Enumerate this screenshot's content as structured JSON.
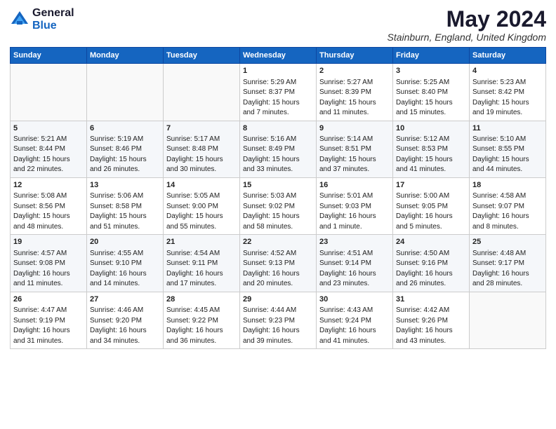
{
  "header": {
    "logo_general": "General",
    "logo_blue": "Blue",
    "month_title": "May 2024",
    "location": "Stainburn, England, United Kingdom"
  },
  "weekdays": [
    "Sunday",
    "Monday",
    "Tuesday",
    "Wednesday",
    "Thursday",
    "Friday",
    "Saturday"
  ],
  "weeks": [
    [
      {
        "day": "",
        "info": ""
      },
      {
        "day": "",
        "info": ""
      },
      {
        "day": "",
        "info": ""
      },
      {
        "day": "1",
        "info": "Sunrise: 5:29 AM\nSunset: 8:37 PM\nDaylight: 15 hours\nand 7 minutes."
      },
      {
        "day": "2",
        "info": "Sunrise: 5:27 AM\nSunset: 8:39 PM\nDaylight: 15 hours\nand 11 minutes."
      },
      {
        "day": "3",
        "info": "Sunrise: 5:25 AM\nSunset: 8:40 PM\nDaylight: 15 hours\nand 15 minutes."
      },
      {
        "day": "4",
        "info": "Sunrise: 5:23 AM\nSunset: 8:42 PM\nDaylight: 15 hours\nand 19 minutes."
      }
    ],
    [
      {
        "day": "5",
        "info": "Sunrise: 5:21 AM\nSunset: 8:44 PM\nDaylight: 15 hours\nand 22 minutes."
      },
      {
        "day": "6",
        "info": "Sunrise: 5:19 AM\nSunset: 8:46 PM\nDaylight: 15 hours\nand 26 minutes."
      },
      {
        "day": "7",
        "info": "Sunrise: 5:17 AM\nSunset: 8:48 PM\nDaylight: 15 hours\nand 30 minutes."
      },
      {
        "day": "8",
        "info": "Sunrise: 5:16 AM\nSunset: 8:49 PM\nDaylight: 15 hours\nand 33 minutes."
      },
      {
        "day": "9",
        "info": "Sunrise: 5:14 AM\nSunset: 8:51 PM\nDaylight: 15 hours\nand 37 minutes."
      },
      {
        "day": "10",
        "info": "Sunrise: 5:12 AM\nSunset: 8:53 PM\nDaylight: 15 hours\nand 41 minutes."
      },
      {
        "day": "11",
        "info": "Sunrise: 5:10 AM\nSunset: 8:55 PM\nDaylight: 15 hours\nand 44 minutes."
      }
    ],
    [
      {
        "day": "12",
        "info": "Sunrise: 5:08 AM\nSunset: 8:56 PM\nDaylight: 15 hours\nand 48 minutes."
      },
      {
        "day": "13",
        "info": "Sunrise: 5:06 AM\nSunset: 8:58 PM\nDaylight: 15 hours\nand 51 minutes."
      },
      {
        "day": "14",
        "info": "Sunrise: 5:05 AM\nSunset: 9:00 PM\nDaylight: 15 hours\nand 55 minutes."
      },
      {
        "day": "15",
        "info": "Sunrise: 5:03 AM\nSunset: 9:02 PM\nDaylight: 15 hours\nand 58 minutes."
      },
      {
        "day": "16",
        "info": "Sunrise: 5:01 AM\nSunset: 9:03 PM\nDaylight: 16 hours\nand 1 minute."
      },
      {
        "day": "17",
        "info": "Sunrise: 5:00 AM\nSunset: 9:05 PM\nDaylight: 16 hours\nand 5 minutes."
      },
      {
        "day": "18",
        "info": "Sunrise: 4:58 AM\nSunset: 9:07 PM\nDaylight: 16 hours\nand 8 minutes."
      }
    ],
    [
      {
        "day": "19",
        "info": "Sunrise: 4:57 AM\nSunset: 9:08 PM\nDaylight: 16 hours\nand 11 minutes."
      },
      {
        "day": "20",
        "info": "Sunrise: 4:55 AM\nSunset: 9:10 PM\nDaylight: 16 hours\nand 14 minutes."
      },
      {
        "day": "21",
        "info": "Sunrise: 4:54 AM\nSunset: 9:11 PM\nDaylight: 16 hours\nand 17 minutes."
      },
      {
        "day": "22",
        "info": "Sunrise: 4:52 AM\nSunset: 9:13 PM\nDaylight: 16 hours\nand 20 minutes."
      },
      {
        "day": "23",
        "info": "Sunrise: 4:51 AM\nSunset: 9:14 PM\nDaylight: 16 hours\nand 23 minutes."
      },
      {
        "day": "24",
        "info": "Sunrise: 4:50 AM\nSunset: 9:16 PM\nDaylight: 16 hours\nand 26 minutes."
      },
      {
        "day": "25",
        "info": "Sunrise: 4:48 AM\nSunset: 9:17 PM\nDaylight: 16 hours\nand 28 minutes."
      }
    ],
    [
      {
        "day": "26",
        "info": "Sunrise: 4:47 AM\nSunset: 9:19 PM\nDaylight: 16 hours\nand 31 minutes."
      },
      {
        "day": "27",
        "info": "Sunrise: 4:46 AM\nSunset: 9:20 PM\nDaylight: 16 hours\nand 34 minutes."
      },
      {
        "day": "28",
        "info": "Sunrise: 4:45 AM\nSunset: 9:22 PM\nDaylight: 16 hours\nand 36 minutes."
      },
      {
        "day": "29",
        "info": "Sunrise: 4:44 AM\nSunset: 9:23 PM\nDaylight: 16 hours\nand 39 minutes."
      },
      {
        "day": "30",
        "info": "Sunrise: 4:43 AM\nSunset: 9:24 PM\nDaylight: 16 hours\nand 41 minutes."
      },
      {
        "day": "31",
        "info": "Sunrise: 4:42 AM\nSunset: 9:26 PM\nDaylight: 16 hours\nand 43 minutes."
      },
      {
        "day": "",
        "info": ""
      }
    ]
  ]
}
